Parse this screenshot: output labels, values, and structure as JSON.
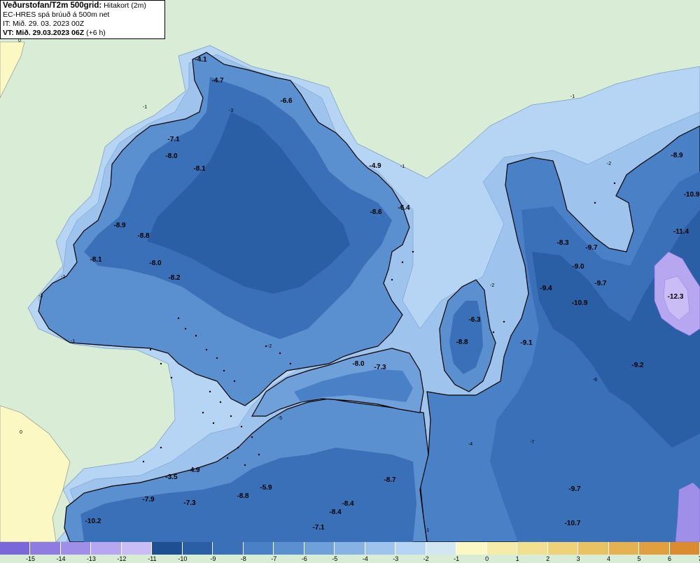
{
  "header": {
    "title": "Veðurstofan/T2m 500grid:",
    "title_suffix": " Hitakort (2m)",
    "model": "EC-HRES spá brúuð á 500m net",
    "init_time": "IT: Mið. 29. 03. 2023 00Z",
    "valid_time": "VT: Mið. 29.03.2023 06Z",
    "valid_offset": " (+6 h)"
  },
  "legend": {
    "colors": [
      "#7b68d8",
      "#8f7ce0",
      "#a08fe8",
      "#b7a7f0",
      "#cabdf6",
      "#1f4f93",
      "#2a5fa6",
      "#3a70b8",
      "#4a80c6",
      "#5b90d0",
      "#6fa0da",
      "#86b2e4",
      "#9ec4ed",
      "#b6d5f5",
      "#d2e7f0",
      "#fbf8c4",
      "#f6ecaa",
      "#f2e091",
      "#eed27a",
      "#e9c266",
      "#e6b152",
      "#e19f40",
      "#db8c30"
    ],
    "labels": [
      "-15",
      "-14",
      "-13",
      "-12",
      "-11",
      "-10",
      "-9",
      "-8",
      "-7",
      "-6",
      "-5",
      "-4",
      "-3",
      "-2",
      "-1",
      "0",
      "1",
      "2",
      "3",
      "4",
      "5",
      "6",
      "7"
    ]
  },
  "map": {
    "sea_colors": {
      "land_green": "#d9ecd6",
      "shelf_blue": "#b6d5f5",
      "yellow": "#fbf8c4",
      "coast_line": "#000000"
    },
    "labels": [
      {
        "text": "-4.1",
        "gx": 287,
        "gy": 88
      },
      {
        "text": "-4.7",
        "gx": 311,
        "gy": 118
      },
      {
        "text": "-6.6",
        "gx": 409,
        "gy": 147
      },
      {
        "text": "-7.1",
        "gx": 248,
        "gy": 202
      },
      {
        "text": "-8.0",
        "gx": 245,
        "gy": 226
      },
      {
        "text": "-8.1",
        "gx": 285,
        "gy": 244
      },
      {
        "text": "-4.9",
        "gx": 536,
        "gy": 240
      },
      {
        "text": "-8.6",
        "gx": 537,
        "gy": 306
      },
      {
        "text": "-6.4",
        "gx": 577,
        "gy": 300
      },
      {
        "text": "-8.9",
        "gx": 171,
        "gy": 325
      },
      {
        "text": "-8.8",
        "gx": 205,
        "gy": 340
      },
      {
        "text": "-8.1",
        "gx": 137,
        "gy": 374
      },
      {
        "text": "-8.0",
        "gx": 222,
        "gy": 379
      },
      {
        "text": "-8.2",
        "gx": 249,
        "gy": 400
      },
      {
        "text": "-6.3",
        "gx": 678,
        "gy": 460
      },
      {
        "text": "-8.8",
        "gx": 660,
        "gy": 492
      },
      {
        "text": "-8.0",
        "gx": 512,
        "gy": 523
      },
      {
        "text": "-7.3",
        "gx": 543,
        "gy": 528
      },
      {
        "text": "-9.1",
        "gx": 752,
        "gy": 493
      },
      {
        "text": "-8.9",
        "gx": 967,
        "gy": 225
      },
      {
        "text": "-10.9",
        "gx": 988,
        "gy": 281
      },
      {
        "text": "-11.4",
        "gx": 973,
        "gy": 334
      },
      {
        "text": "-8.3",
        "gx": 804,
        "gy": 350
      },
      {
        "text": "-9.7",
        "gx": 845,
        "gy": 357
      },
      {
        "text": "-9.0",
        "gx": 826,
        "gy": 384
      },
      {
        "text": "-9.4",
        "gx": 780,
        "gy": 415
      },
      {
        "text": "-9.7",
        "gx": 858,
        "gy": 408
      },
      {
        "text": "-10.9",
        "gx": 828,
        "gy": 436
      },
      {
        "text": "-12.3",
        "gx": 965,
        "gy": 427
      },
      {
        "text": "-9.2",
        "gx": 911,
        "gy": 525
      },
      {
        "text": "-8.7",
        "gx": 557,
        "gy": 689
      },
      {
        "text": "-3.5",
        "gx": 245,
        "gy": 685
      },
      {
        "text": "-4.9",
        "gx": 277,
        "gy": 675
      },
      {
        "text": "-5.9",
        "gx": 380,
        "gy": 700
      },
      {
        "text": "-7.9",
        "gx": 212,
        "gy": 717
      },
      {
        "text": "-7.3",
        "gx": 271,
        "gy": 722
      },
      {
        "text": "-8.8",
        "gx": 347,
        "gy": 712
      },
      {
        "text": "-8.4",
        "gx": 497,
        "gy": 723
      },
      {
        "text": "-8.4",
        "gx": 479,
        "gy": 735
      },
      {
        "text": "-10.2",
        "gx": 133,
        "gy": 748
      },
      {
        "text": "-7.1",
        "gx": 455,
        "gy": 757
      },
      {
        "text": "-9.7",
        "gx": 821,
        "gy": 702
      },
      {
        "text": "-10.7",
        "gx": 818,
        "gy": 751
      }
    ],
    "contour_labels": [
      {
        "text": "-1",
        "gx": 207,
        "gy": 155
      },
      {
        "text": "-1",
        "gx": 818,
        "gy": 140
      },
      {
        "text": "-1",
        "gx": 575,
        "gy": 240
      },
      {
        "text": "-1",
        "gx": 104,
        "gy": 490
      },
      {
        "text": "-1",
        "gx": 610,
        "gy": 760
      },
      {
        "text": "-2",
        "gx": 90,
        "gy": 398
      },
      {
        "text": "-2",
        "gx": 385,
        "gy": 497
      },
      {
        "text": "-2",
        "gx": 870,
        "gy": 236
      },
      {
        "text": "-2",
        "gx": 703,
        "gy": 410
      },
      {
        "text": "-3",
        "gx": 58,
        "gy": 425
      },
      {
        "text": "-3",
        "gx": 330,
        "gy": 160
      },
      {
        "text": "-4",
        "gx": 672,
        "gy": 637
      },
      {
        "text": "-5",
        "gx": 400,
        "gy": 600
      },
      {
        "text": "-6",
        "gx": 850,
        "gy": 545
      },
      {
        "text": "-7",
        "gx": 760,
        "gy": 634
      },
      {
        "text": "0",
        "gx": 30,
        "gy": 620
      },
      {
        "text": "0",
        "gx": 28,
        "gy": 60
      }
    ]
  }
}
